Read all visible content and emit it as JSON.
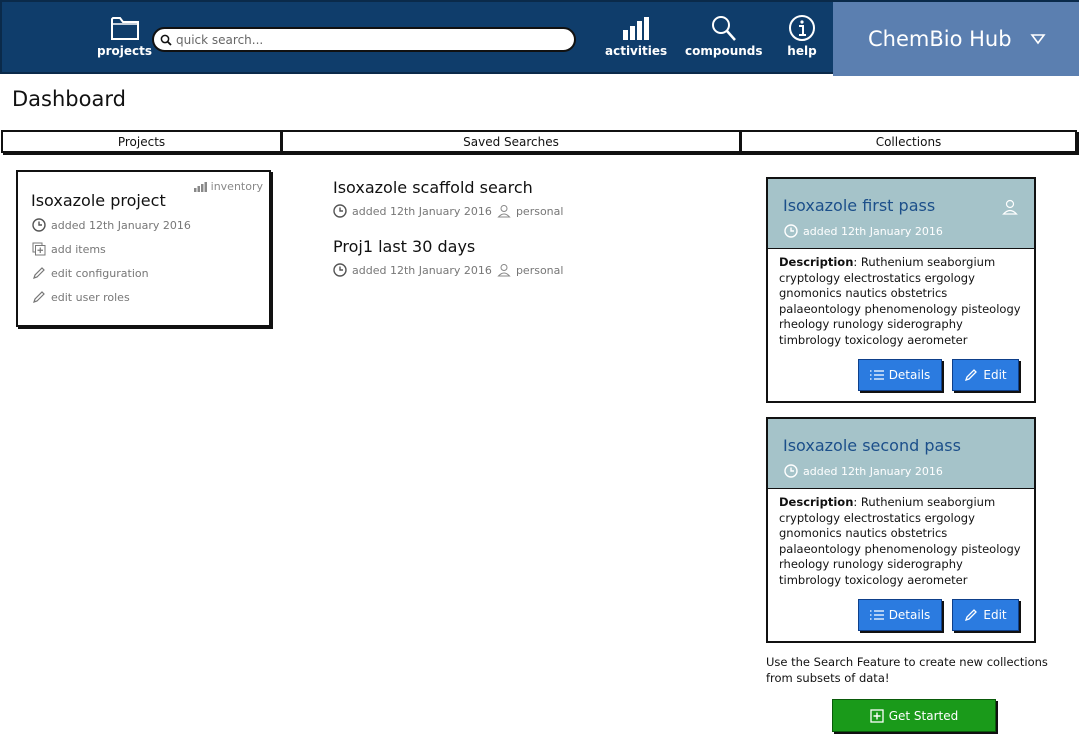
{
  "nav": {
    "projects_label": "projects",
    "search_placeholder": "quick search...",
    "activities_label": "activities",
    "compounds_label": "compounds",
    "help_label": "help",
    "brand": "ChemBio Hub"
  },
  "page_title": "Dashboard",
  "tabs": [
    "Projects",
    "Saved Searches",
    "Collections"
  ],
  "projects": [
    {
      "title": "Isoxazole project",
      "badge": "inventory",
      "added": "added 12th January 2016",
      "actions": [
        "add items",
        "edit configuration",
        "edit user roles"
      ]
    }
  ],
  "saved_searches": [
    {
      "title": "Isoxazole scaffold search",
      "added": "added 12th January 2016",
      "scope": "personal"
    },
    {
      "title": "Proj1 last 30 days",
      "added": "added 12th January 2016",
      "scope": "personal"
    }
  ],
  "collections": [
    {
      "title": "Isoxazole first pass",
      "added": "added 12th January 2016",
      "desc_label": "Description",
      "desc_text": ": Ruthenium seaborgium cryptology electrostatics ergology gnomonics nautics obstetrics palaeontology phenomenology pisteology rheology runology siderography timbrology toxicology aerometer",
      "details_label": "Details",
      "edit_label": "Edit"
    },
    {
      "title": "Isoxazole second pass",
      "added": "added 12th January 2016",
      "desc_label": "Description",
      "desc_text": ": Ruthenium seaborgium cryptology electrostatics ergology gnomonics nautics obstetrics palaeontology phenomenology pisteology rheology runology siderography timbrology toxicology aerometer",
      "details_label": "Details",
      "edit_label": "Edit"
    }
  ],
  "collections_hint": "Use the Search Feature to create new collections from subsets of data!",
  "get_started_label": "Get Started",
  "colors": {
    "nav_bg": "#0f3d6b",
    "brand_bg": "#5b7fb0",
    "collection_header": "#a5c3c9",
    "button_blue": "#2b7be0",
    "button_green": "#1a9a1a"
  }
}
